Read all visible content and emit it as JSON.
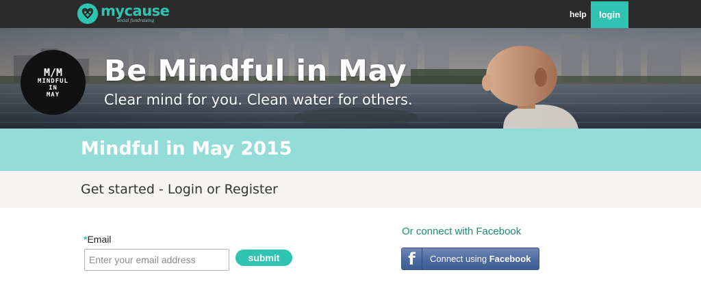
{
  "nav": {
    "logo_word": "mycause",
    "logo_tagline": "social fundraising",
    "help_label": "help",
    "login_label": "login"
  },
  "hero": {
    "badge_mark": "M/M",
    "badge_lines": [
      "MINDFUL",
      "IN",
      "MAY"
    ],
    "title": "Be Mindful in May",
    "subtitle": "Clear mind for you. Clean water for others."
  },
  "campaign": {
    "title": "Mindful in May 2015"
  },
  "get_started": {
    "title": "Get started - Login or Register"
  },
  "form": {
    "required_marker": "*",
    "email_label": "Email",
    "email_placeholder": "Enter your email address",
    "email_value": "",
    "submit_label": "submit"
  },
  "facebook": {
    "heading": "Or connect with Facebook",
    "button_prefix": "Connect using ",
    "button_brand": "Facebook",
    "icon_glyph": "f"
  },
  "colors": {
    "accent": "#2ec4b1",
    "campaign_bar": "#93dcd7",
    "nav_bg": "#2b2b2b",
    "facebook_blue": "#4c6a9f",
    "facebook_heading": "#1e8c73"
  },
  "icons": {
    "logo": "heart-infinity-logo-icon",
    "facebook": "facebook-f-icon"
  }
}
